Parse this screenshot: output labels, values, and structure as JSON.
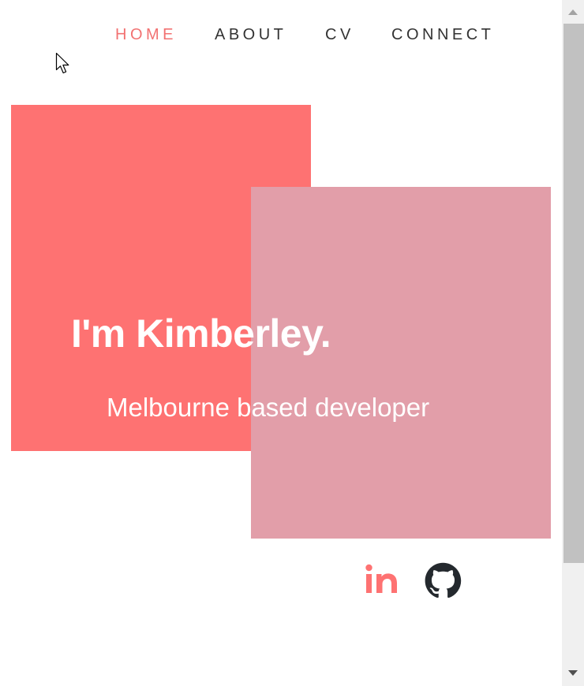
{
  "nav": {
    "items": [
      {
        "label": "HOME",
        "active": true
      },
      {
        "label": "ABOUT",
        "active": false
      },
      {
        "label": "CV",
        "active": false
      },
      {
        "label": "CONNECT",
        "active": false
      }
    ]
  },
  "hero": {
    "title": "I'm Kimberley.",
    "subtitle": "Melbourne based developer"
  },
  "social": {
    "linkedin_icon": "linkedin-icon",
    "github_icon": "github-icon"
  },
  "colors": {
    "accent": "#f27272",
    "nav_text": "#333333",
    "coral_block": "#fe7272",
    "pink_block": "#e29ea9",
    "hero_text": "#ffffff",
    "linkedin": "#fe7272",
    "github": "#24292e"
  }
}
